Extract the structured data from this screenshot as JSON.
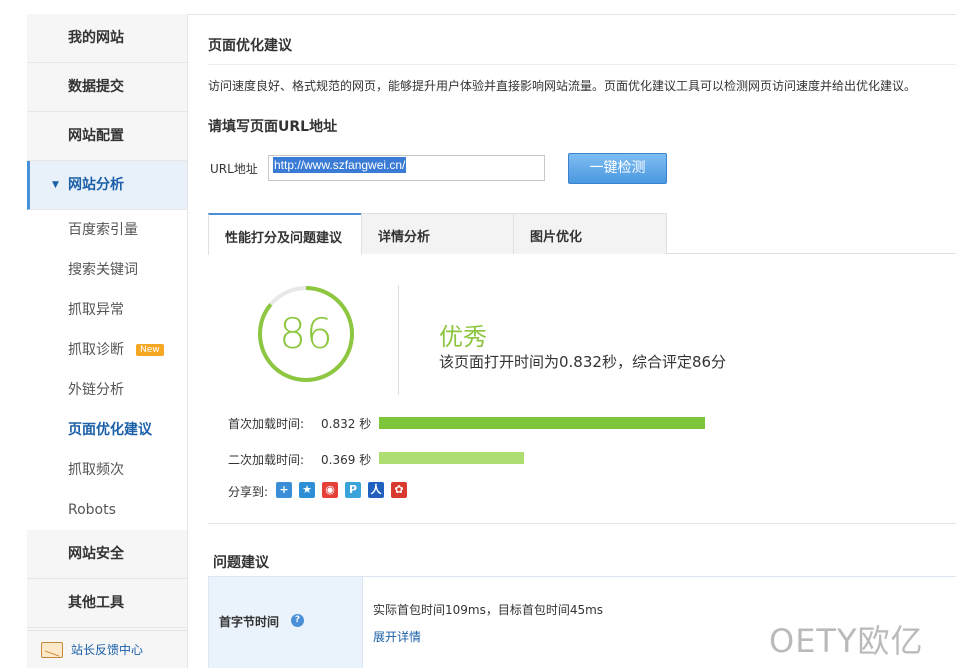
{
  "sidebar": {
    "top_items": [
      {
        "label": "我的网站"
      },
      {
        "label": "数据提交"
      },
      {
        "label": "网站配置"
      }
    ],
    "active_section": {
      "label": "网站分析",
      "caret": "▼"
    },
    "sub_items": [
      {
        "label": "百度索引量"
      },
      {
        "label": "搜索关键词"
      },
      {
        "label": "抓取异常"
      },
      {
        "label": "抓取诊断",
        "badge": "New"
      },
      {
        "label": "外链分析"
      },
      {
        "label": "页面优化建议"
      },
      {
        "label": "抓取频次"
      },
      {
        "label": "Robots"
      }
    ],
    "bottom_items": [
      {
        "label": "网站安全"
      },
      {
        "label": "其他工具"
      }
    ],
    "feedback": {
      "label": "站长反馈中心",
      "icon": "mail-icon"
    }
  },
  "main": {
    "title": "页面优化建议",
    "intro": "访问速度良好、格式规范的网页，能够提升用户体验并直接影响网站流量。页面优化建议工具可以检测网页访问速度并给出优化建议。",
    "url_heading": "请填写页面URL地址",
    "url_label": "URL地址",
    "url_value": "http://www.szfangwei.cn/",
    "check_button": "一键检测",
    "tabs": [
      {
        "label": "性能打分及问题建议",
        "active": true
      },
      {
        "label": "详情分析",
        "active": false
      },
      {
        "label": "图片优化",
        "active": false
      }
    ]
  },
  "score": {
    "value": "86",
    "max": 100,
    "grade": "优秀",
    "summary": "该页面打开时间为0.832秒，综合评定86分",
    "ring_color": "#8dc63f"
  },
  "metrics": [
    {
      "label": "首次加载时间:",
      "value": "0.832",
      "unit": "秒",
      "seconds": 0.832,
      "color": "#7dc63b"
    },
    {
      "label": "二次加载时间:",
      "value": "0.369",
      "unit": "秒",
      "seconds": 0.369,
      "color": "#aede72"
    }
  ],
  "share": {
    "label": "分享到:",
    "icons": [
      {
        "name": "share-plus-icon",
        "glyph": "+",
        "color": "#3d8ed8"
      },
      {
        "name": "qzone-icon",
        "glyph": "★",
        "color": "#2f8fd6"
      },
      {
        "name": "weibo-icon",
        "glyph": "◉",
        "color": "#e6403b"
      },
      {
        "name": "tencent-weibo-icon",
        "glyph": "P",
        "color": "#3aa3d9"
      },
      {
        "name": "renren-icon",
        "glyph": "人",
        "color": "#1f5fbd"
      },
      {
        "name": "kaixin-icon",
        "glyph": "✿",
        "color": "#d93a2f"
      }
    ]
  },
  "issues": {
    "heading": "问题建议",
    "rows": [
      {
        "key": "首字节时间",
        "help": "?",
        "desc": "实际首包时间109ms，目标首包时间45ms",
        "link": "展开详情"
      }
    ]
  },
  "watermark": "OETY欧亿"
}
